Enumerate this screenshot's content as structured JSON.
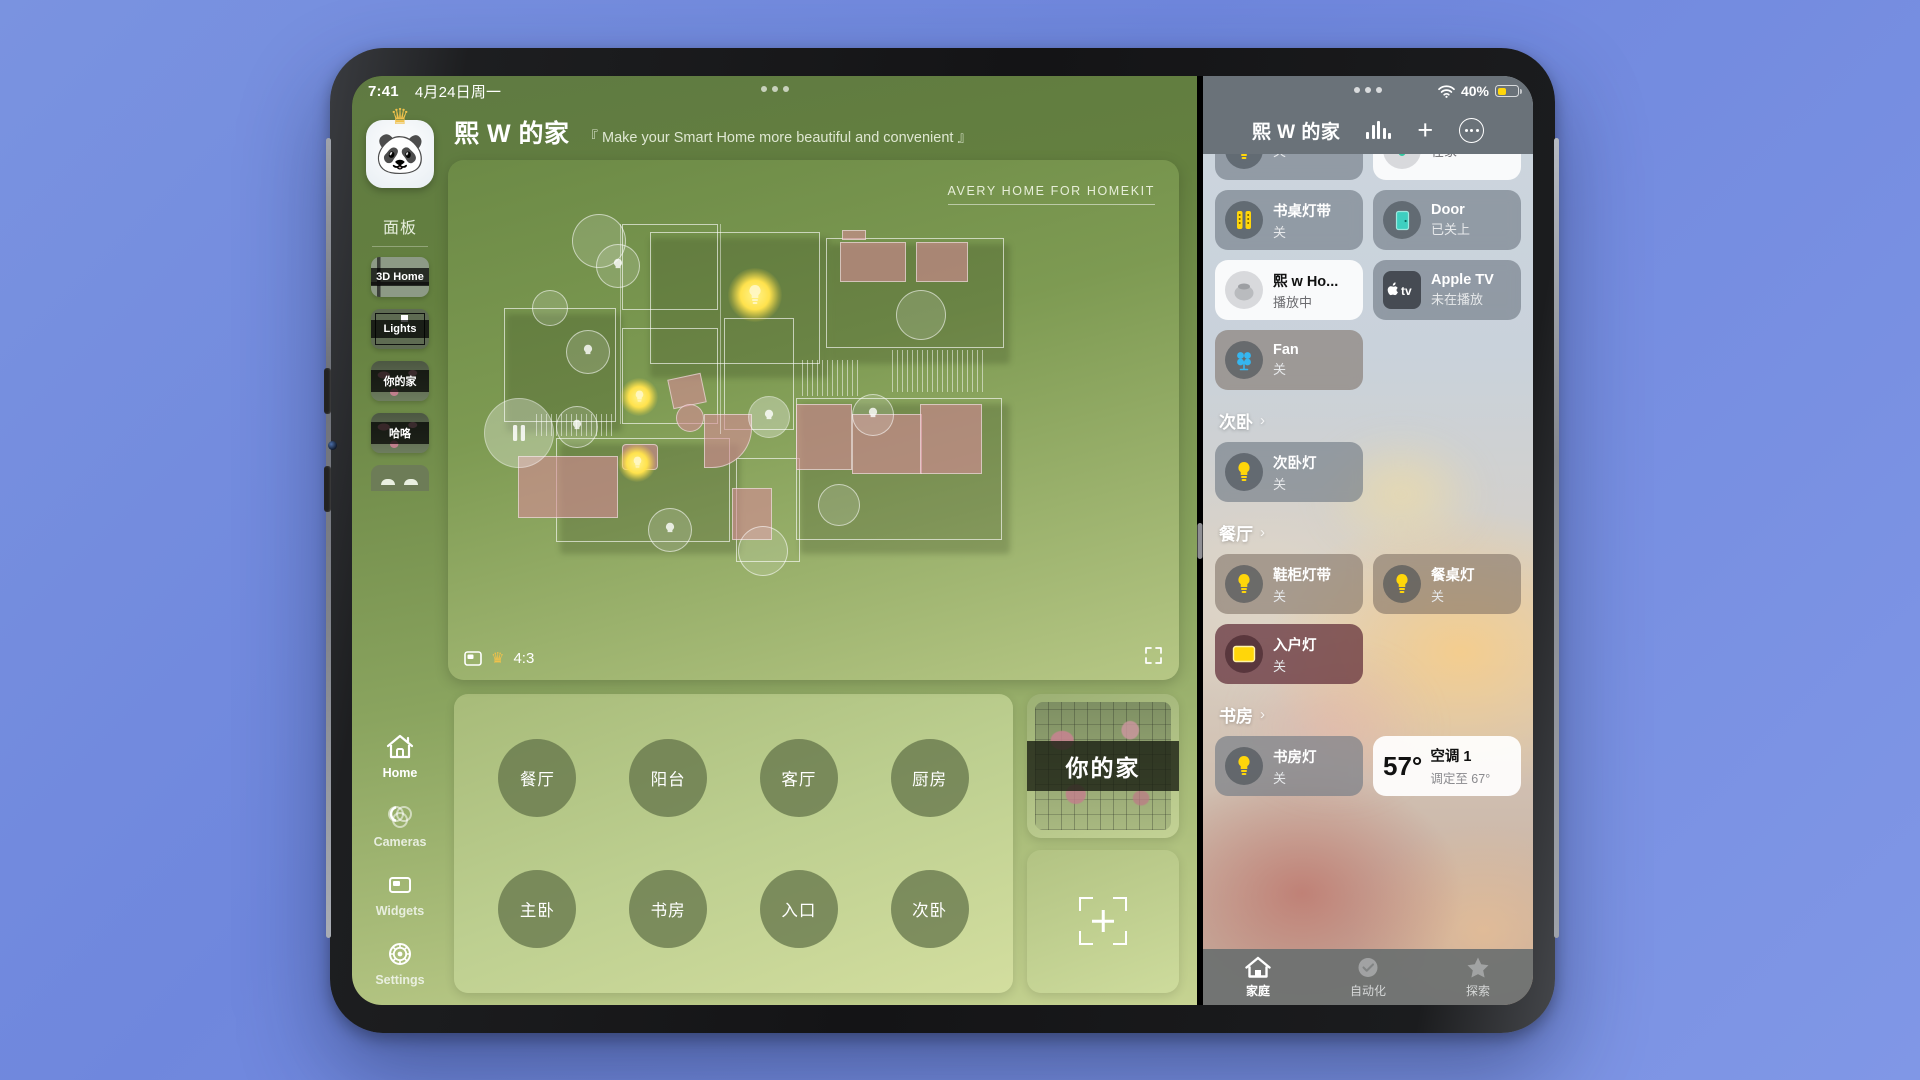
{
  "statusbar": {
    "time": "7:41",
    "date": "4月24日周一"
  },
  "sidebar": {
    "avatar_icon": "panda-avatar",
    "crown_icon": "crown-icon",
    "section_label": "面板",
    "thumbs": [
      {
        "label": "3D Home",
        "name": "panel-thumb-3d-home"
      },
      {
        "label": "Lights",
        "name": "panel-thumb-lights"
      },
      {
        "label": "你的家",
        "name": "panel-thumb-your-home"
      },
      {
        "label": "哈咯",
        "name": "panel-thumb-hello"
      }
    ],
    "navs": [
      {
        "label": "Home",
        "icon": "home-icon"
      },
      {
        "label": "Cameras",
        "icon": "cameras-icon"
      },
      {
        "label": "Widgets",
        "icon": "widgets-icon"
      },
      {
        "label": "Settings",
        "icon": "settings-gear-icon"
      }
    ]
  },
  "app": {
    "title": "熙 W 的家",
    "subtitle": "『 Make your Smart Home more beautiful and convenient 』",
    "plan_brand": "AVERY HOME FOR HOMEKIT",
    "toolbar": {
      "aspect_icon": "aspect-frame-icon",
      "crown_icon": "crown-icon",
      "ratio": "4:3",
      "expand_icon": "expand-arrows-icon"
    },
    "rooms": [
      "餐厅",
      "阳台",
      "客厅",
      "厨房",
      "主卧",
      "书房",
      "入口",
      "次卧"
    ],
    "side_cards": {
      "preview_label": "你的家",
      "add_icon": "scan-add-icon"
    }
  },
  "homekit": {
    "status": {
      "wifi_icon": "wifi-icon",
      "battery_text": "40%",
      "battery_icon": "battery-icon"
    },
    "header": {
      "title": "熙 W 的家",
      "eq_icon": "audio-levels-icon",
      "add_icon": "plus-icon",
      "more_icon": "more-ellipsis-icon"
    },
    "favorites": [
      {
        "name": "",
        "state": "关",
        "icon": "bulb-icon",
        "style": "grey",
        "clipped": true
      },
      {
        "name": "",
        "state": "在家",
        "icon": "sensor-icon",
        "style": "white",
        "clipped": true
      },
      {
        "name": "书桌灯带",
        "state": "关",
        "icon": "lightstrip-icon",
        "style": "grey"
      },
      {
        "name": "Door",
        "state": "已关上",
        "icon": "door-icon",
        "style": "grey"
      },
      {
        "name": "熙 w Ho...",
        "state": "播放中",
        "icon": "homepod-icon",
        "style": "white"
      },
      {
        "name": "Apple TV",
        "state": "未在播放",
        "icon": "appletv-icon",
        "style": "grey"
      },
      {
        "name": "Fan",
        "state": "关",
        "icon": "fan-icon",
        "style": "warm"
      }
    ],
    "rooms": [
      {
        "name": "次卧",
        "tiles": [
          {
            "name": "次卧灯",
            "state": "关",
            "icon": "bulb-icon",
            "style": "grey"
          }
        ]
      },
      {
        "name": "餐厅",
        "tiles": [
          {
            "name": "鞋柜灯带",
            "state": "关",
            "icon": "bulb-icon",
            "style": "warm"
          },
          {
            "name": "餐桌灯",
            "state": "关",
            "icon": "bulb-icon",
            "style": "warm"
          },
          {
            "name": "入户灯",
            "state": "关",
            "icon": "panel-light-icon",
            "style": "dark-red"
          }
        ]
      },
      {
        "name": "书房",
        "tiles": [
          {
            "name": "书房灯",
            "state": "关",
            "icon": "bulb-icon",
            "style": "grey"
          }
        ],
        "temp_tile": {
          "value": "57°",
          "name": "空调 1",
          "sub": "调定至 67°"
        }
      }
    ],
    "tabs": [
      {
        "label": "家庭",
        "icon": "home-icon",
        "active": true
      },
      {
        "label": "自动化",
        "icon": "clock-icon",
        "active": false
      },
      {
        "label": "探索",
        "icon": "star-icon",
        "active": false
      }
    ]
  }
}
